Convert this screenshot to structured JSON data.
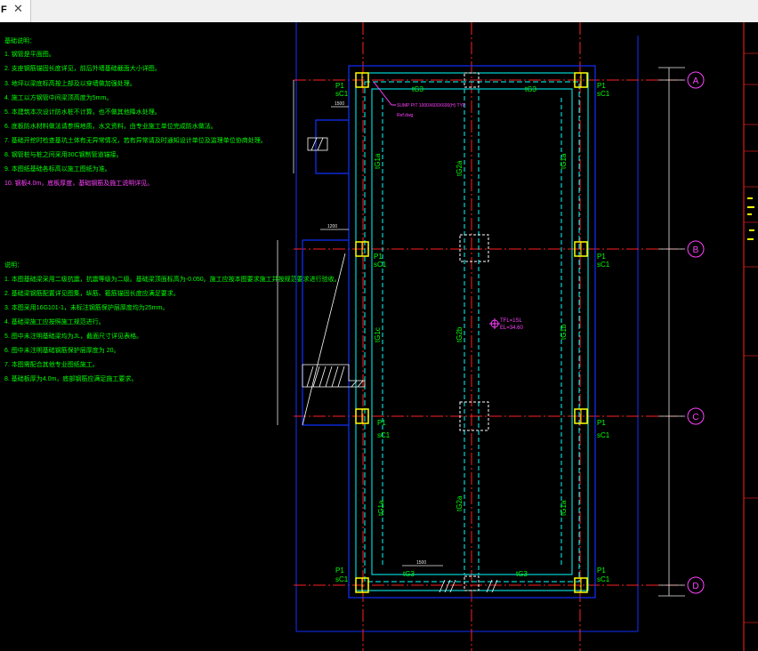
{
  "tab": {
    "label": "F",
    "close_icon": "close-icon"
  },
  "notes_a": {
    "title": "基础说明：",
    "lines": [
      "1. 钢管是平面图。",
      "2. 支座钢筋锚固长度详见，前后外墙基础截面大小详图。",
      "3. 地坪以梁底标高按上部及以穿墙做加强处理。",
      "4. 施工以方钢管中间梁顶高度为5mm。",
      "5. 本建筑本次设计防水桩不计算，也不做其他降水处理。",
      "6. 底板防水材料做法请参照地质，水文资料，由专业施工单位完成防水做法。",
      "7. 基础开挖时检查基坑土体有无异常情况，若有异常请及时通知设计单位及监理单位协商处理。",
      "8. 钢管桩与桩之间采用30C钢制管道锚接。",
      "9. 本图纸基础各标高以施工图纸为准。"
    ],
    "highlight": "10. 钢板4.0m，底板厚度，基础钢筋及施工说明详见。"
  },
  "notes_b": {
    "title": "说明：",
    "lines": [
      "1. 本图基础梁采用二级抗震，抗震等级为二级。基础梁顶面标高为-0.050。施工应按本图要求施工并按规范要求进行验收。",
      "2. 基础梁钢筋配置详见图集，纵筋、箍筋锚固长度应满足要求。",
      "3. 本图采用16G101-1，未标注钢筋保护层厚度均为25mm。",
      "4. 基础梁施工应按照施工规范进行。",
      "5. 图中未注明基础梁均为JL，截面尺寸详见表格。",
      "6. 图中未注明基础钢筋保护层厚度为 20。",
      "7. 本图需配合其他专业图纸施工。",
      "8. 基础板厚为4.0m，底部钢筋应满足施工要求。"
    ]
  },
  "plan": {
    "axes": [
      "A",
      "B",
      "C",
      "D"
    ],
    "column_label": "P1",
    "column_sub": "sC1",
    "beam_top": "tG3",
    "beam_top2": "tG3",
    "beam_left_a": "tG1a",
    "beam_left_b": "tG1c",
    "beam_left_c": "tG1a",
    "beam_mid_a": "tG2a",
    "beam_mid_b": "tG2b",
    "beam_mid_c": "tG2a",
    "beam_right_a": "tG1a",
    "beam_right_b": "tG1b",
    "beam_right_c": "tG1a",
    "beam_bottom": "tG3",
    "beam_bottom2": "tG3",
    "callout": "SUMP PIT 1000X600X600(H) TYP.",
    "callout_sub": "Ref.dwg",
    "level_1": "TFL=1SL",
    "level_2": "EL=34.60",
    "dim_1500": "1500",
    "dim_1200": "1200",
    "dim_1500b": "1500"
  },
  "colors": {
    "background": "#000000",
    "axis_line": "#ff2020",
    "beam_line": "#00ffff",
    "outline": "#1030ff",
    "text_green": "#00ff00",
    "text_magenta": "#ff40ff",
    "column_yellow": "#ffff00",
    "dim_white": "#e8e8e8"
  }
}
